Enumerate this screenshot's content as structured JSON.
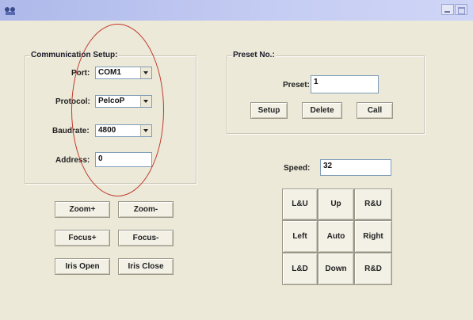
{
  "window": {
    "icon": "app-icon",
    "controls": {
      "minimize": "minimize-icon",
      "maximize": "maximize-icon"
    }
  },
  "comm_setup": {
    "title": "Communication Setup:",
    "port": {
      "label": "Port:",
      "value": "COM1"
    },
    "protocol": {
      "label": "Protocol:",
      "value": "PelcoP"
    },
    "baudrate": {
      "label": "Baudrate:",
      "value": "4800"
    },
    "address": {
      "label": "Address:",
      "value": "0"
    }
  },
  "preset": {
    "title": "Preset No.:",
    "label": "Preset:",
    "value": "1",
    "buttons": {
      "setup": "Setup",
      "delete": "Delete",
      "call": "Call"
    }
  },
  "lens": {
    "zoom_in": "Zoom+",
    "zoom_out": "Zoom-",
    "focus_in": "Focus+",
    "focus_out": "Focus-",
    "iris_open": "Iris Open",
    "iris_close": "Iris Close"
  },
  "speed": {
    "label": "Speed:",
    "value": "32"
  },
  "ptz": {
    "lu": "L&U",
    "up": "Up",
    "ru": "R&U",
    "left": "Left",
    "auto": "Auto",
    "right": "Right",
    "ld": "L&D",
    "down": "Down",
    "rd": "R&D"
  },
  "colors": {
    "annotation_circle": "#c0392b",
    "title_bar": "#b7c0ee",
    "face": "#ece9d8"
  }
}
